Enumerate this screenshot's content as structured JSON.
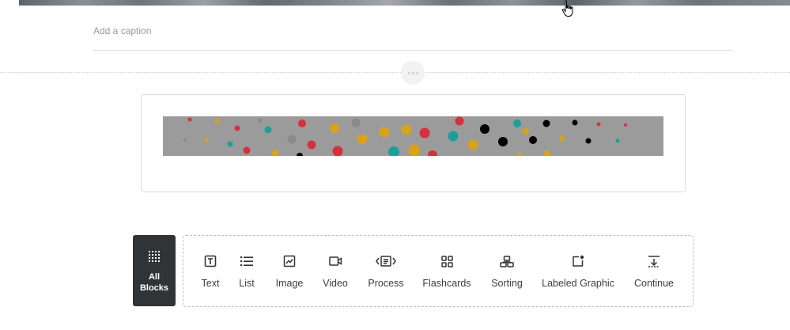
{
  "caption": {
    "placeholder": "Add a caption"
  },
  "all_blocks": {
    "label_line1": "All",
    "label_line2": "Blocks"
  },
  "toolbar": {
    "items": [
      {
        "label": "Text",
        "icon": "text-icon"
      },
      {
        "label": "List",
        "icon": "list-icon"
      },
      {
        "label": "Image",
        "icon": "image-icon"
      },
      {
        "label": "Video",
        "icon": "video-icon"
      },
      {
        "label": "Process",
        "icon": "process-icon"
      },
      {
        "label": "Flashcards",
        "icon": "flashcards-icon"
      },
      {
        "label": "Sorting",
        "icon": "sorting-icon"
      },
      {
        "label": "Labeled Graphic",
        "icon": "labeled-graphic-icon"
      },
      {
        "label": "Continue",
        "icon": "continue-icon"
      }
    ]
  },
  "colors": {
    "dark_block": "#313436",
    "banner_gray": "#9b9b9b",
    "dot_red": "#d6303d",
    "dot_yellow": "#d9a21b",
    "dot_teal": "#1e9e9a",
    "dot_black": "#000000",
    "dot_gray": "#8a8a8a"
  }
}
